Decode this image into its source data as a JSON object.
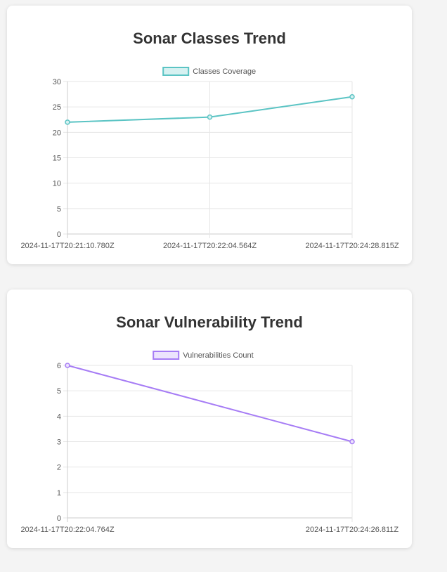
{
  "charts": {
    "classes": {
      "title": "Sonar Classes Trend"
    },
    "vulns": {
      "title": "Sonar Vulnerability Trend"
    }
  },
  "chart_data": [
    {
      "type": "line",
      "title": "Sonar Classes Trend",
      "categories": [
        "2024-11-17T20:21:10.780Z",
        "2024-11-17T20:22:04.564Z",
        "2024-11-17T20:24:28.815Z"
      ],
      "series": [
        {
          "name": "Classes Coverage",
          "values": [
            22,
            23,
            27
          ],
          "color": "#5bc4c4",
          "fill": "#d6f1f1"
        }
      ],
      "ylim": [
        0,
        30
      ],
      "yticks": [
        0,
        5,
        10,
        15,
        20,
        25,
        30
      ],
      "legend": "top",
      "grid": true
    },
    {
      "type": "line",
      "title": "Sonar Vulnerability Trend",
      "categories": [
        "2024-11-17T20:22:04.764Z",
        "2024-11-17T20:24:26.811Z"
      ],
      "series": [
        {
          "name": "Vulnerabilities Count",
          "values": [
            6,
            3
          ],
          "color": "#a67cf5",
          "fill": "#ece3fd"
        }
      ],
      "ylim": [
        0,
        6
      ],
      "yticks": [
        0,
        1,
        2,
        3,
        4,
        5,
        6
      ],
      "legend": "top",
      "grid": true
    }
  ]
}
